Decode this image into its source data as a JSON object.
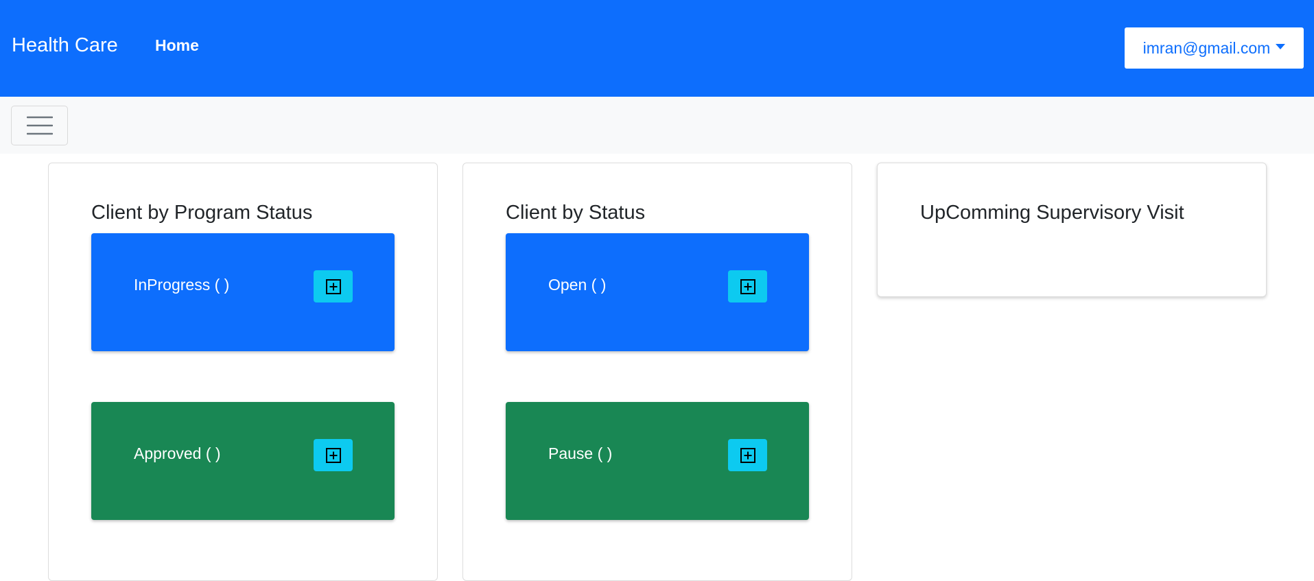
{
  "navbar": {
    "brand": "Health Care",
    "home_label": "Home",
    "user_email": "imran@gmail.com"
  },
  "cards": [
    {
      "title": "Client by Program Status",
      "tiles": [
        {
          "label": "InProgress ( )",
          "color": "#0d6efd"
        },
        {
          "label": "Approved ( )",
          "color": "#198754"
        }
      ]
    },
    {
      "title": "Client by Status",
      "tiles": [
        {
          "label": "Open ( )",
          "color": "#0d6efd"
        },
        {
          "label": "Pause ( )",
          "color": "#198754"
        }
      ]
    },
    {
      "title": "UpComming Supervisory Visit",
      "tiles": []
    }
  ],
  "icons": {
    "menu": "hamburger-menu-icon",
    "expand": "plus-square-icon",
    "dropdown": "caret-down-icon"
  },
  "colors": {
    "primary": "#0d6efd",
    "success": "#198754",
    "info": "#0dcaf0",
    "light": "#f8f9fa"
  }
}
